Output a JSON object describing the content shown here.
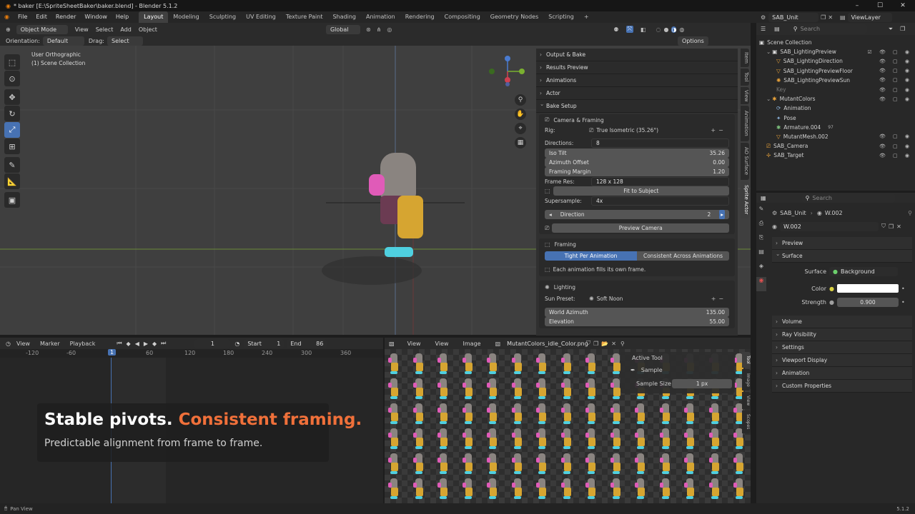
{
  "window": {
    "title": "* baker [E:\\SpriteSheetBaker\\baker.blend] - Blender 5.1.2",
    "min": "–",
    "max": "☐",
    "close": "✕"
  },
  "menus": [
    "File",
    "Edit",
    "Render",
    "Window",
    "Help"
  ],
  "workspaces": [
    "Layout",
    "Modeling",
    "Sculpting",
    "UV Editing",
    "Texture Paint",
    "Shading",
    "Animation",
    "Rendering",
    "Compositing",
    "Geometry Nodes",
    "Scripting"
  ],
  "active_workspace": "Layout",
  "add_workspace": "+",
  "scene_name": "SAB_Unit",
  "view_layer": "ViewLayer",
  "viewport_header": {
    "mode": "Object Mode",
    "menus": [
      "View",
      "Select",
      "Add",
      "Object"
    ],
    "transform_orientation": "Global",
    "orientation_label": "Orientation:",
    "orientation_value": "Default",
    "drag_label": "Drag:",
    "drag_value": "Select Box",
    "options": "Options"
  },
  "viewport": {
    "view_name": "User Orthographic",
    "collection": "(1) Scene Collection"
  },
  "npanel": {
    "collapsed": [
      "Output & Bake",
      "Results Preview",
      "Animations",
      "Actor"
    ],
    "bake_setup": "Bake Setup",
    "camera_framing": "Camera & Framing",
    "rig_label": "Rig:",
    "rig_value": "True Isometric (35.26°)",
    "directions_label": "Directions:",
    "directions_value": "8",
    "iso_tilt_label": "Iso Tilt",
    "iso_tilt_value": "35.26",
    "azimuth_label": "Azimuth Offset",
    "azimuth_value": "0.00",
    "framing_margin_label": "Framing Margin",
    "framing_margin_value": "1.20",
    "frame_res_label": "Frame Res:",
    "frame_res_value": "128 x 128",
    "fit_subject": "Fit to Subject",
    "supersample_label": "Supersample:",
    "supersample_value": "4x",
    "direction_label": "Direction",
    "direction_value": "2",
    "preview_camera": "Preview Camera",
    "framing_title": "Framing",
    "tight_per_animation": "Tight Per Animation",
    "consistent_across": "Consistent Across Animations",
    "framing_note": "Each animation fills its own frame.",
    "lighting_title": "Lighting",
    "sun_preset_label": "Sun Preset:",
    "sun_preset_value": "Soft Noon",
    "world_azimuth_label": "World Azimuth",
    "world_azimuth_value": "135.00",
    "elevation_label": "Elevation",
    "elevation_value": "55.00"
  },
  "side_tabs": [
    "Item",
    "Tool",
    "View",
    "Animation",
    "AO Surface",
    "Sprite Actor"
  ],
  "active_side_tab": "Sprite Actor",
  "timeline": {
    "menus": [
      "View",
      "Marker",
      "Playback"
    ],
    "current_frame": "1",
    "start_label": "Start",
    "start_value": "1",
    "end_label": "End",
    "end_value": "86",
    "ticks": [
      "-120",
      "-60",
      "1",
      "60",
      "120",
      "180",
      "240",
      "300",
      "360"
    ],
    "overlay_title_white": "Stable pivots.",
    "overlay_title_orange": "Consistent framing.",
    "overlay_subtitle": "Predictable alignment from frame to frame."
  },
  "image_editor": {
    "menus": [
      "View",
      "View",
      "Image"
    ],
    "image_name": "MutantColors_idle_Color.png",
    "active_tool_title": "Active Tool",
    "tool_name": "Sample",
    "sample_size_label": "Sample Size",
    "sample_size_value": "1 px",
    "side_tabs": [
      "Tool",
      "Image",
      "View",
      "Scopes"
    ]
  },
  "outliner": {
    "search_placeholder": "Search",
    "root": "Scene Collection",
    "items": [
      {
        "label": "SAB_LightingPreview",
        "depth": 1
      },
      {
        "label": "SAB_LightingDirection",
        "depth": 2
      },
      {
        "label": "SAB_LightingPreviewFloor",
        "depth": 2
      },
      {
        "label": "SAB_LightingPreviewSun",
        "depth": 2
      },
      {
        "label": "Key",
        "depth": 1
      },
      {
        "label": "MutantColors",
        "depth": 1
      },
      {
        "label": "Animation",
        "depth": 2
      },
      {
        "label": "Pose",
        "depth": 2
      },
      {
        "label": "Armature.004",
        "depth": 2
      },
      {
        "label": "MutantMesh.002",
        "depth": 2
      },
      {
        "label": "SAB_Camera",
        "depth": 1
      },
      {
        "label": "SAB_Target",
        "depth": 1
      }
    ],
    "armature_badge": "97"
  },
  "properties": {
    "search_placeholder": "Search",
    "breadcrumb_scene": "SAB_Unit",
    "breadcrumb_world": "W.002",
    "world_name": "W.002",
    "sections_top": [
      "Preview",
      "Surface"
    ],
    "surface_label": "Surface",
    "surface_value": "Background",
    "color_label": "Color",
    "strength_label": "Strength",
    "strength_value": "0.900",
    "sections": [
      "Volume",
      "Ray Visibility",
      "Settings",
      "Viewport Display",
      "Animation",
      "Custom Properties"
    ],
    "color_swatch": "#ffffff"
  },
  "status": {
    "left": "Pan View",
    "version": "5.1.2"
  },
  "colors": {
    "accent": "#4772b3",
    "orange": "#f0703a",
    "playhead": "#4772b3"
  }
}
